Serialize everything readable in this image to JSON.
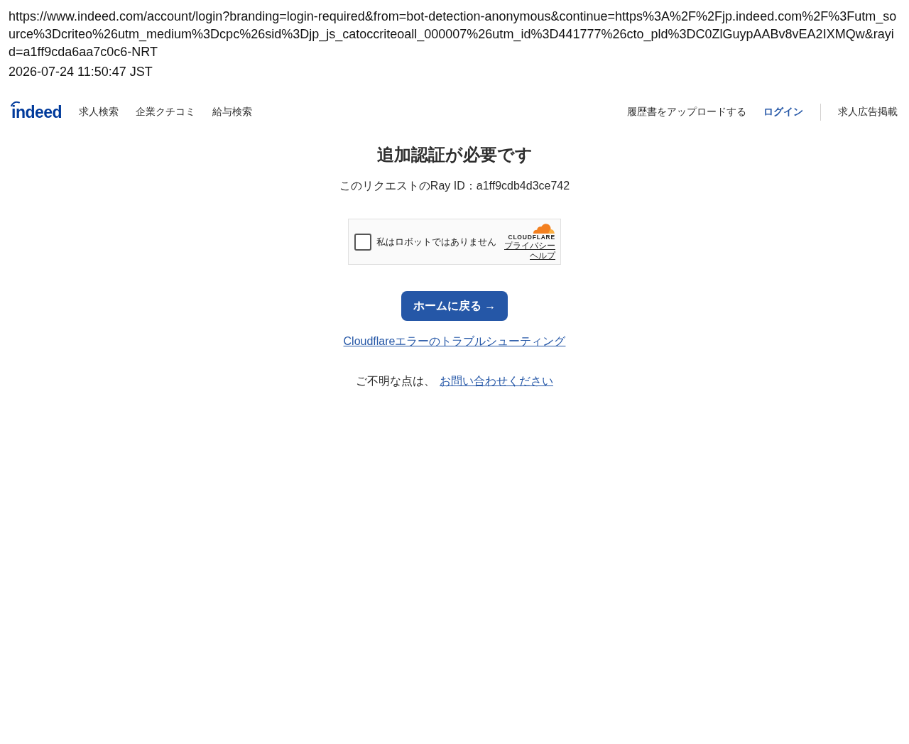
{
  "address": {
    "url": "https://www.indeed.com/account/login?branding=login-required&from=bot-detection-anonymous&continue=https%3A%2F%2Fjp.indeed.com%2F%3Futm_source%3Dcriteo%26utm_medium%3Dcpc%26sid%3Djp_js_catoccriteoall_000007%26utm_id%3D441777%26cto_pld%3DC0ZlGuypAABv8vEA2IXMQw&rayid=a1ff9cda6aa7c0c6-NRT",
    "timestamp": "2026-07-24 11:50:47 JST"
  },
  "header": {
    "logo": "indeed",
    "nav": [
      {
        "label": "求人検索"
      },
      {
        "label": "企業クチコミ"
      },
      {
        "label": "給与検索"
      }
    ],
    "actions": [
      {
        "label": "履歴書をアップロードする",
        "kind": "link"
      },
      {
        "label": "ログイン",
        "kind": "signin"
      }
    ],
    "employer_link": "求人広告掲載"
  },
  "challenge": {
    "title": "追加認証が必要です",
    "ray_id_text": "このリクエストのRay ID：a1ff9cdb4d3ce742",
    "captcha": {
      "checked": false,
      "label": "私はロボットではありません",
      "brand": "CLOUDFLARE",
      "links": [
        "プライバシー",
        "ヘルプ"
      ]
    },
    "home_button": "ホームに戻る →",
    "troubleshoot_link": "Cloudflareエラーのトラブルシューティング",
    "contact": {
      "text": "ご不明な点は、",
      "link": "お問い合わせください"
    }
  }
}
